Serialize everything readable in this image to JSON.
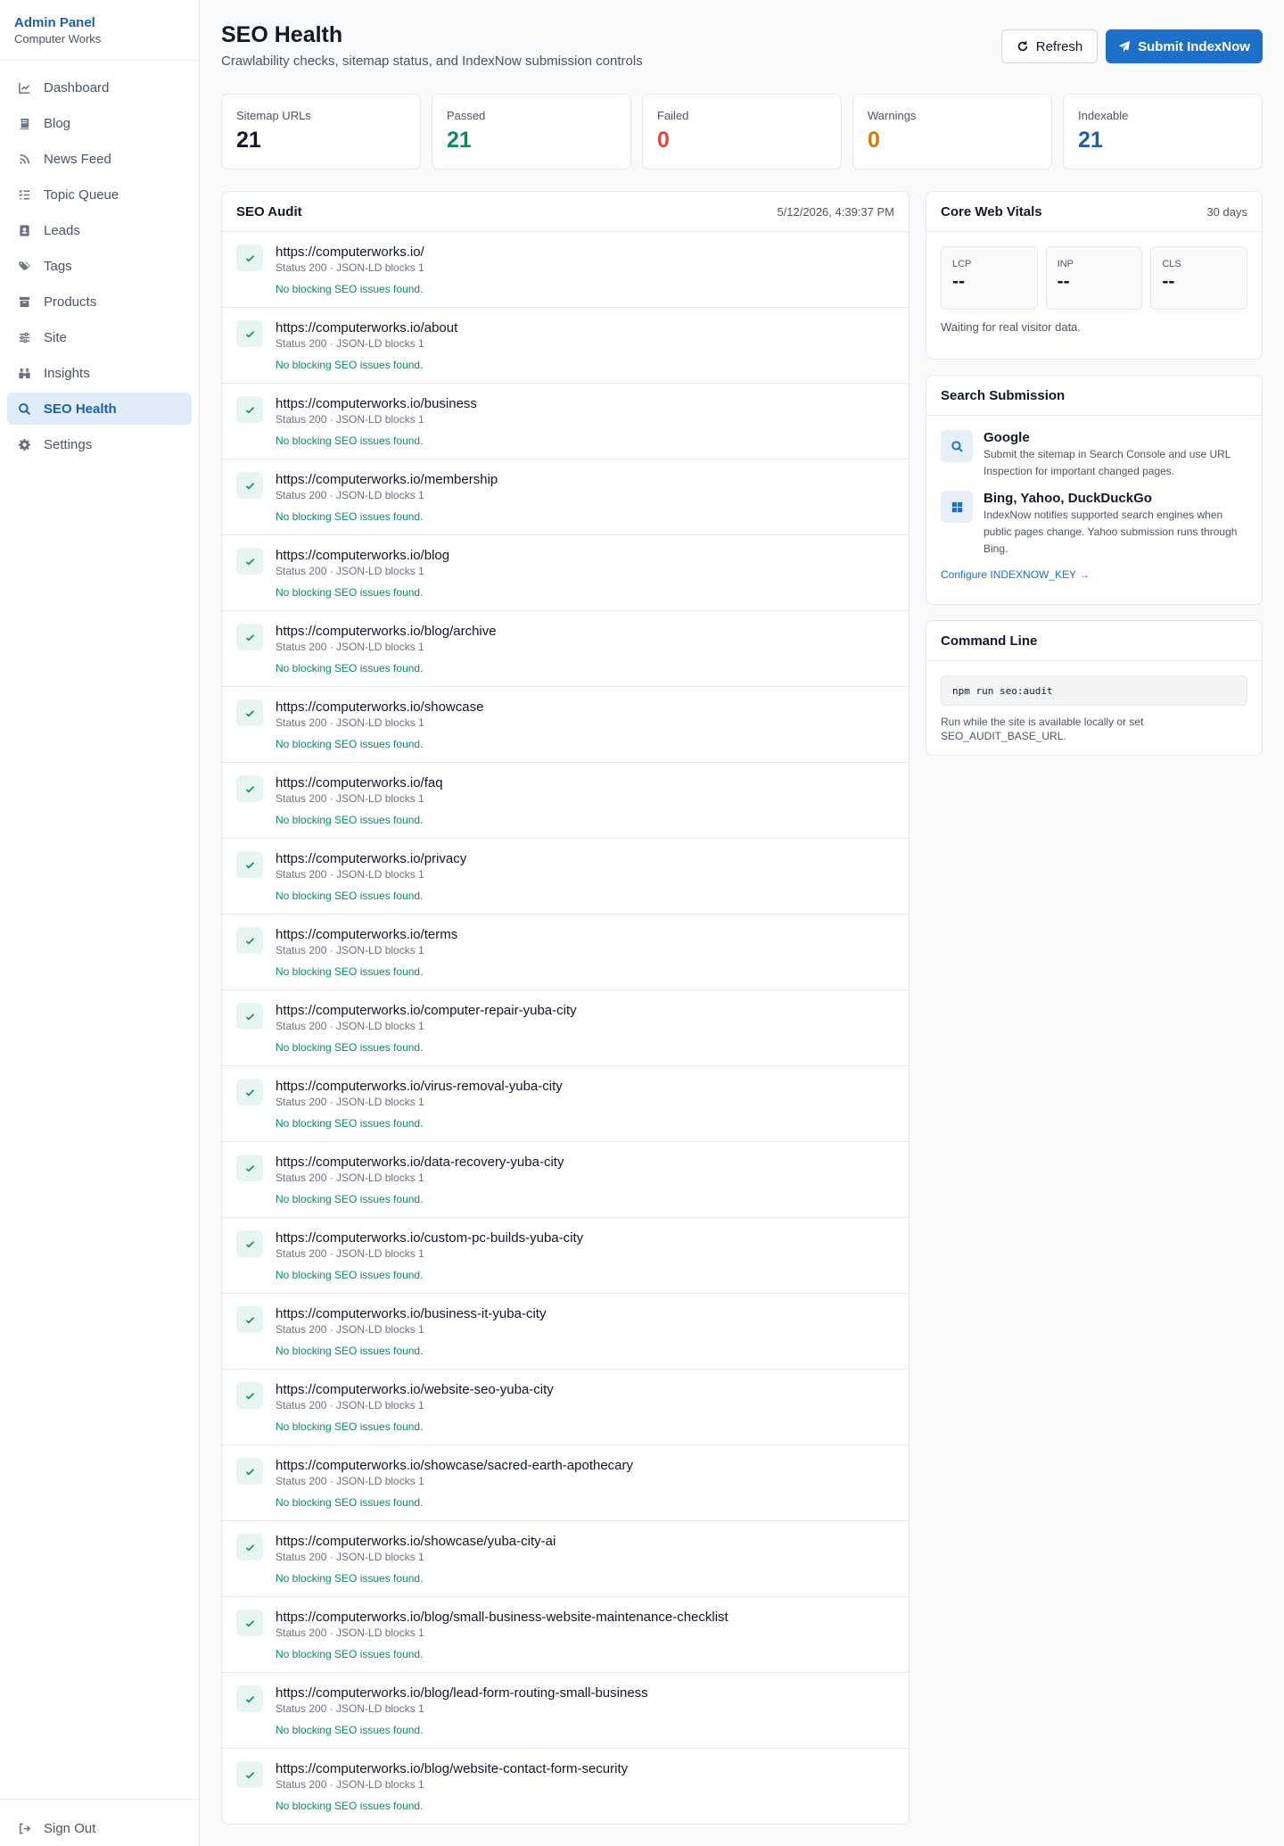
{
  "sidebar": {
    "brand_title": "Admin Panel",
    "brand_subtitle": "Computer Works",
    "items": [
      {
        "label": "Dashboard",
        "icon": "chart-line-icon"
      },
      {
        "label": "Blog",
        "icon": "book-icon"
      },
      {
        "label": "News Feed",
        "icon": "rss-icon"
      },
      {
        "label": "Topic Queue",
        "icon": "list-check-icon"
      },
      {
        "label": "Leads",
        "icon": "contact-card-icon"
      },
      {
        "label": "Tags",
        "icon": "tags-icon"
      },
      {
        "label": "Products",
        "icon": "box-icon"
      },
      {
        "label": "Site",
        "icon": "sliders-icon"
      },
      {
        "label": "Insights",
        "icon": "binoculars-icon"
      },
      {
        "label": "SEO Health",
        "icon": "search-chart-icon",
        "active": true
      },
      {
        "label": "Settings",
        "icon": "gear-icon"
      }
    ],
    "signout_label": "Sign Out"
  },
  "header": {
    "title": "SEO Health",
    "subtitle": "Crawlability checks, sitemap status, and IndexNow submission controls",
    "refresh_label": "Refresh",
    "submit_label": "Submit IndexNow"
  },
  "stats": [
    {
      "label": "Sitemap URLs",
      "value": "21",
      "color": "#111827"
    },
    {
      "label": "Passed",
      "value": "21",
      "color": "#0f8a5f"
    },
    {
      "label": "Failed",
      "value": "0",
      "color": "#dc4b3e"
    },
    {
      "label": "Warnings",
      "value": "0",
      "color": "#d97706"
    },
    {
      "label": "Indexable",
      "value": "21",
      "color": "#1e5fa8"
    }
  ],
  "audit": {
    "title": "SEO Audit",
    "timestamp": "5/12/2026, 4:39:37 PM",
    "rows": [
      {
        "url": "https://computerworks.io/",
        "meta": "Status 200 · JSON-LD blocks 1",
        "result": "No blocking SEO issues found."
      },
      {
        "url": "https://computerworks.io/about",
        "meta": "Status 200 · JSON-LD blocks 1",
        "result": "No blocking SEO issues found."
      },
      {
        "url": "https://computerworks.io/business",
        "meta": "Status 200 · JSON-LD blocks 1",
        "result": "No blocking SEO issues found."
      },
      {
        "url": "https://computerworks.io/membership",
        "meta": "Status 200 · JSON-LD blocks 1",
        "result": "No blocking SEO issues found."
      },
      {
        "url": "https://computerworks.io/blog",
        "meta": "Status 200 · JSON-LD blocks 1",
        "result": "No blocking SEO issues found."
      },
      {
        "url": "https://computerworks.io/blog/archive",
        "meta": "Status 200 · JSON-LD blocks 1",
        "result": "No blocking SEO issues found."
      },
      {
        "url": "https://computerworks.io/showcase",
        "meta": "Status 200 · JSON-LD blocks 1",
        "result": "No blocking SEO issues found."
      },
      {
        "url": "https://computerworks.io/faq",
        "meta": "Status 200 · JSON-LD blocks 1",
        "result": "No blocking SEO issues found."
      },
      {
        "url": "https://computerworks.io/privacy",
        "meta": "Status 200 · JSON-LD blocks 1",
        "result": "No blocking SEO issues found."
      },
      {
        "url": "https://computerworks.io/terms",
        "meta": "Status 200 · JSON-LD blocks 1",
        "result": "No blocking SEO issues found."
      },
      {
        "url": "https://computerworks.io/computer-repair-yuba-city",
        "meta": "Status 200 · JSON-LD blocks 1",
        "result": "No blocking SEO issues found."
      },
      {
        "url": "https://computerworks.io/virus-removal-yuba-city",
        "meta": "Status 200 · JSON-LD blocks 1",
        "result": "No blocking SEO issues found."
      },
      {
        "url": "https://computerworks.io/data-recovery-yuba-city",
        "meta": "Status 200 · JSON-LD blocks 1",
        "result": "No blocking SEO issues found."
      },
      {
        "url": "https://computerworks.io/custom-pc-builds-yuba-city",
        "meta": "Status 200 · JSON-LD blocks 1",
        "result": "No blocking SEO issues found."
      },
      {
        "url": "https://computerworks.io/business-it-yuba-city",
        "meta": "Status 200 · JSON-LD blocks 1",
        "result": "No blocking SEO issues found."
      },
      {
        "url": "https://computerworks.io/website-seo-yuba-city",
        "meta": "Status 200 · JSON-LD blocks 1",
        "result": "No blocking SEO issues found."
      },
      {
        "url": "https://computerworks.io/showcase/sacred-earth-apothecary",
        "meta": "Status 200 · JSON-LD blocks 1",
        "result": "No blocking SEO issues found."
      },
      {
        "url": "https://computerworks.io/showcase/yuba-city-ai",
        "meta": "Status 200 · JSON-LD blocks 1",
        "result": "No blocking SEO issues found."
      },
      {
        "url": "https://computerworks.io/blog/small-business-website-maintenance-checklist",
        "meta": "Status 200 · JSON-LD blocks 1",
        "result": "No blocking SEO issues found."
      },
      {
        "url": "https://computerworks.io/blog/lead-form-routing-small-business",
        "meta": "Status 200 · JSON-LD blocks 1",
        "result": "No blocking SEO issues found."
      },
      {
        "url": "https://computerworks.io/blog/website-contact-form-security",
        "meta": "Status 200 · JSON-LD blocks 1",
        "result": "No blocking SEO issues found."
      }
    ]
  },
  "vitals": {
    "title": "Core Web Vitals",
    "range": "30 days",
    "items": [
      {
        "label": "LCP",
        "value": "--"
      },
      {
        "label": "INP",
        "value": "--"
      },
      {
        "label": "CLS",
        "value": "--"
      }
    ],
    "note": "Waiting for real visitor data."
  },
  "search": {
    "title": "Search Submission",
    "engines": [
      {
        "name": "Google",
        "icon": "search-icon",
        "desc": "Submit the sitemap in Search Console and use URL Inspection for important changed pages."
      },
      {
        "name": "Bing, Yahoo, DuckDuckGo",
        "icon": "windows-icon",
        "desc": "IndexNow notifies supported search engines when public pages change. Yahoo submission runs through Bing."
      }
    ],
    "config_link": "Configure INDEXNOW_KEY →"
  },
  "command": {
    "title": "Command Line",
    "code": "npm run seo:audit",
    "note": "Run while the site is available locally or set SEO_AUDIT_BASE_URL."
  }
}
